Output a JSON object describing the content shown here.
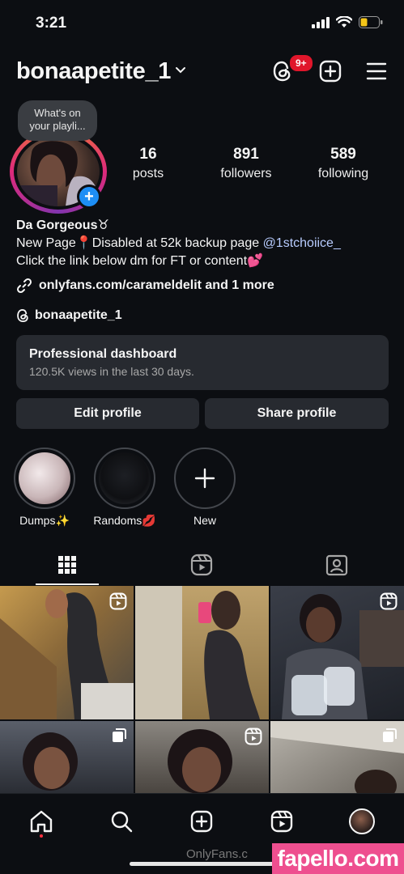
{
  "status_bar": {
    "time": "3:21"
  },
  "header": {
    "username": "bonaapetite_1",
    "threads_badge": "9+"
  },
  "note": {
    "text_line1": "What's on",
    "text_line2": "your playli..."
  },
  "stats": [
    {
      "value": "16",
      "label": "posts"
    },
    {
      "value": "891",
      "label": "followers"
    },
    {
      "value": "589",
      "label": "following"
    }
  ],
  "bio": {
    "name": "Da Gorgeous♉",
    "line1_prefix": "New Page📍Disabled at 52k backup page ",
    "line1_mention": "@1stchoiice_",
    "line2": "Click the link below dm for FT or content💕",
    "link": "onlyfans.com/carameldelit and 1 more",
    "threads_handle": "bonaapetite_1"
  },
  "dashboard": {
    "title": "Professional dashboard",
    "subtitle": "120.5K views in the last 30 days."
  },
  "buttons": {
    "edit": "Edit profile",
    "share": "Share profile"
  },
  "highlights": [
    {
      "label": "Dumps✨"
    },
    {
      "label": "Randoms💋"
    },
    {
      "label": "New"
    }
  ],
  "watermark": {
    "left": "OnlyFans.c",
    "right": "fapello.com"
  },
  "colors": {
    "accent_blue": "#1d8ef5",
    "badge_red": "#e0162b",
    "card_bg": "#272a30",
    "watermark_pink": "#ee4f8f"
  }
}
